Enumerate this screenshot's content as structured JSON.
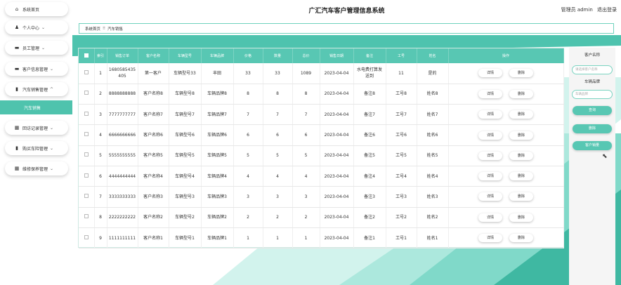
{
  "app": {
    "title": "广汇汽车客户管理信息系统",
    "user_label": "管理员 admin",
    "logout_label": "退出登录"
  },
  "sidebar": {
    "items": [
      {
        "icon": "home-icon",
        "glyph": "⌂",
        "label": "系统首页",
        "chev": ""
      },
      {
        "icon": "person-icon",
        "glyph": "♟",
        "label": "个人中心",
        "chev": "⌄"
      },
      {
        "icon": "staff-icon",
        "glyph": "▬",
        "label": "员工管理",
        "chev": "⌄"
      },
      {
        "icon": "customer-icon",
        "glyph": "▬",
        "label": "客户信息管理",
        "chev": "⌄"
      },
      {
        "icon": "car-sales-icon",
        "glyph": "▮",
        "label": "汽车销售管理",
        "chev": "^"
      }
    ],
    "active_sub": "汽车销售",
    "items2": [
      {
        "icon": "grid-icon",
        "glyph": "▦",
        "label": "回访记录管理",
        "chev": "⌄"
      },
      {
        "icon": "insurance-icon",
        "glyph": "▮",
        "label": "购买车险管理",
        "chev": "⌄"
      },
      {
        "icon": "grid-icon",
        "glyph": "▦",
        "label": "维修保养管理",
        "chev": "⌄"
      }
    ]
  },
  "breadcrumb": {
    "home": "系统首页",
    "sep": "⠿",
    "current": "汽车销售"
  },
  "table": {
    "headers": [
      "索引",
      "销售订单",
      "客户名称",
      "车辆型号",
      "车辆品牌",
      "价格",
      "数量",
      "总价",
      "销售日期",
      "备注",
      "工号",
      "姓名",
      "操作"
    ],
    "rows": [
      [
        "1",
        "1680585435405",
        "第一客户",
        "车辆型号33",
        "丰田",
        "33",
        "33",
        "1089",
        "2023-04-04",
        "水电费打算发送到",
        "11",
        "是的"
      ],
      [
        "2",
        "8888888888",
        "客户名称8",
        "车辆型号8",
        "车辆品牌8",
        "8",
        "8",
        "8",
        "2023-04-04",
        "备注8",
        "工号8",
        "姓名8"
      ],
      [
        "3",
        "7777777777",
        "客户名称7",
        "车辆型号7",
        "车辆品牌7",
        "7",
        "7",
        "7",
        "2023-04-04",
        "备注7",
        "工号7",
        "姓名7"
      ],
      [
        "4",
        "6666666666",
        "客户名称6",
        "车辆型号6",
        "车辆品牌6",
        "6",
        "6",
        "6",
        "2023-04-04",
        "备注6",
        "工号6",
        "姓名6"
      ],
      [
        "5",
        "5555555555",
        "客户名称5",
        "车辆型号5",
        "车辆品牌5",
        "5",
        "5",
        "5",
        "2023-04-04",
        "备注5",
        "工号5",
        "姓名5"
      ],
      [
        "6",
        "4444444444",
        "客户名称4",
        "车辆型号4",
        "车辆品牌4",
        "4",
        "4",
        "4",
        "2023-04-04",
        "备注4",
        "工号4",
        "姓名4"
      ],
      [
        "7",
        "3333333333",
        "客户名称3",
        "车辆型号3",
        "车辆品牌3",
        "3",
        "3",
        "3",
        "2023-04-04",
        "备注3",
        "工号3",
        "姓名3"
      ],
      [
        "8",
        "2222222222",
        "客户名称2",
        "车辆型号2",
        "车辆品牌2",
        "2",
        "2",
        "2",
        "2023-04-04",
        "备注2",
        "工号2",
        "姓名2"
      ],
      [
        "9",
        "1111111111",
        "客户名称1",
        "车辆型号1",
        "车辆品牌1",
        "1",
        "1",
        "1",
        "2023-04-04",
        "备注1",
        "工号1",
        "姓名1"
      ]
    ],
    "detail_label": "详情",
    "delete_label": "删除"
  },
  "search": {
    "customer_label": "客户名称",
    "customer_placeholder": "请选择客户名称",
    "brand_label": "车辆品牌",
    "brand_placeholder": "车辆品牌",
    "query_label": "查询",
    "delete_label": "删除",
    "stats_label": "客户销量"
  },
  "colors": {
    "accent": "#58c7b3",
    "accent_dark": "#3fa994"
  }
}
